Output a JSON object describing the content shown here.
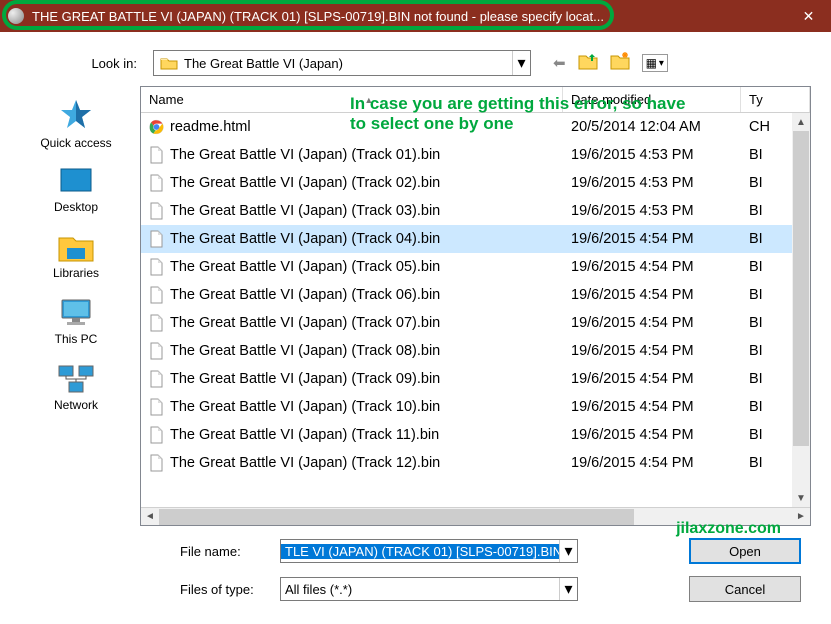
{
  "titlebar": {
    "text": "THE GREAT BATTLE VI (JAPAN) (TRACK 01) [SLPS-00719].BIN not found - please specify locat...",
    "close_glyph": "✕"
  },
  "lookin": {
    "label": "Look in:",
    "value": "The Great Battle VI (Japan)",
    "arrow": "▾",
    "nav_back": "⬅",
    "nav_up": "📁",
    "nav_new": "📁",
    "nav_view": "▦"
  },
  "places": [
    {
      "label": "Quick access"
    },
    {
      "label": "Desktop"
    },
    {
      "label": "Libraries"
    },
    {
      "label": "This PC"
    },
    {
      "label": "Network"
    }
  ],
  "columns": {
    "name": "Name",
    "date": "Date modified",
    "type": "Ty"
  },
  "files": [
    {
      "name": "readme.html",
      "date": "20/5/2014 12:04 AM",
      "type": "CH",
      "icon": "chrome"
    },
    {
      "name": "The Great Battle VI (Japan) (Track 01).bin",
      "date": "19/6/2015 4:53 PM",
      "type": "BI",
      "icon": "doc"
    },
    {
      "name": "The Great Battle VI (Japan) (Track 02).bin",
      "date": "19/6/2015 4:53 PM",
      "type": "BI",
      "icon": "doc"
    },
    {
      "name": "The Great Battle VI (Japan) (Track 03).bin",
      "date": "19/6/2015 4:53 PM",
      "type": "BI",
      "icon": "doc"
    },
    {
      "name": "The Great Battle VI (Japan) (Track 04).bin",
      "date": "19/6/2015 4:54 PM",
      "type": "BI",
      "icon": "doc",
      "selected": true
    },
    {
      "name": "The Great Battle VI (Japan) (Track 05).bin",
      "date": "19/6/2015 4:54 PM",
      "type": "BI",
      "icon": "doc"
    },
    {
      "name": "The Great Battle VI (Japan) (Track 06).bin",
      "date": "19/6/2015 4:54 PM",
      "type": "BI",
      "icon": "doc"
    },
    {
      "name": "The Great Battle VI (Japan) (Track 07).bin",
      "date": "19/6/2015 4:54 PM",
      "type": "BI",
      "icon": "doc"
    },
    {
      "name": "The Great Battle VI (Japan) (Track 08).bin",
      "date": "19/6/2015 4:54 PM",
      "type": "BI",
      "icon": "doc"
    },
    {
      "name": "The Great Battle VI (Japan) (Track 09).bin",
      "date": "19/6/2015 4:54 PM",
      "type": "BI",
      "icon": "doc"
    },
    {
      "name": "The Great Battle VI (Japan) (Track 10).bin",
      "date": "19/6/2015 4:54 PM",
      "type": "BI",
      "icon": "doc"
    },
    {
      "name": "The Great Battle VI (Japan) (Track 11).bin",
      "date": "19/6/2015 4:54 PM",
      "type": "BI",
      "icon": "doc"
    },
    {
      "name": "The Great Battle VI (Japan) (Track 12).bin",
      "date": "19/6/2015 4:54 PM",
      "type": "BI",
      "icon": "doc"
    }
  ],
  "filename": {
    "label": "File name:",
    "value": "TLE VI (JAPAN) (TRACK 01) [SLPS-00719].BIN"
  },
  "filter": {
    "label": "Files of type:",
    "value": "All files (*.*)"
  },
  "buttons": {
    "open": "Open",
    "cancel": "Cancel"
  },
  "annotation": {
    "line1": "In case you are getting this error, so have",
    "line2": "to select one by one"
  },
  "watermark": "jilaxzone.com",
  "glyphs": {
    "sort_asc": "ˆ",
    "dd": "▾",
    "left": "◄",
    "right": "►",
    "up": "▲",
    "down": "▼"
  }
}
